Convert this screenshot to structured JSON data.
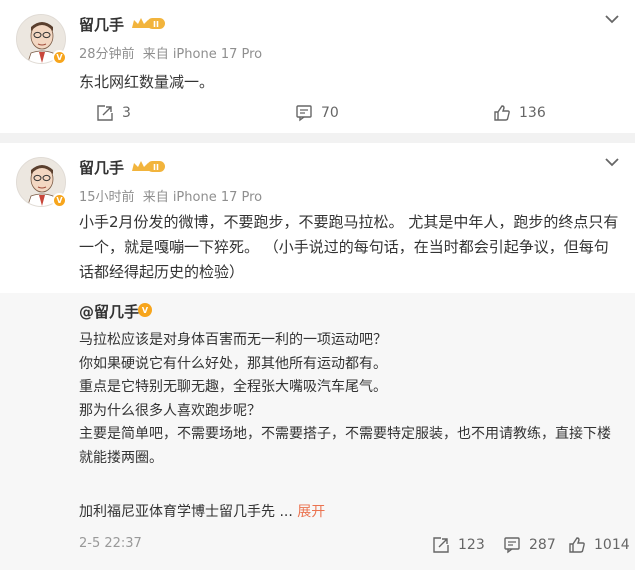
{
  "post1": {
    "author": "留几手",
    "time": "28分钟前",
    "source": "来自 iPhone 17 Pro",
    "text": "东北网红数量减一。",
    "reposts": "3",
    "comments": "70",
    "likes": "136"
  },
  "post2": {
    "author": "留几手",
    "time": "15小时前",
    "source": "来自 iPhone 17 Pro",
    "text_lines": [
      "小手2月份发的微博，不要跑步，不要跑马拉松。 尤其是中年人，跑步的终点只有",
      "一个，就是嘎嘣一下猝死。  （小手说过的每句话，在当时都会引起争议，但每句",
      "话都经得起历史的检验）"
    ],
    "repost": {
      "mention": "@留几手",
      "lines": [
        "马拉松应该是对身体百害而无一利的一项运动吧？",
        "你如果硬说它有什么好处，那其他所有运动都有。",
        "重点是它特别无聊无趣，全程张大嘴吸汽车尾气。",
        "那为什么很多人喜欢跑步呢？",
        "主要是简单吧，不需要场地，不需要搭子，不需要特定服装，也不用请教练，直接下楼",
        "就能搂两圈。"
      ],
      "sign": "加利福尼亚体育学博士留几手先  ...",
      "expand_label": "展开",
      "time": "2-5 22:37",
      "reposts": "123",
      "comments": "287",
      "likes": "1014"
    }
  },
  "icons": {
    "badge": "v-badge-icon",
    "crown": "crown-level-icon",
    "chevron": "chevron-down-icon",
    "repost": "repost-icon",
    "comment": "comment-icon",
    "like": "thumbs-up-icon"
  },
  "colors": {
    "accent": "#eb7350",
    "badge": "#f7a51c",
    "crown": "#f2b43c"
  },
  "badge_text": "V",
  "crown_text": "II"
}
